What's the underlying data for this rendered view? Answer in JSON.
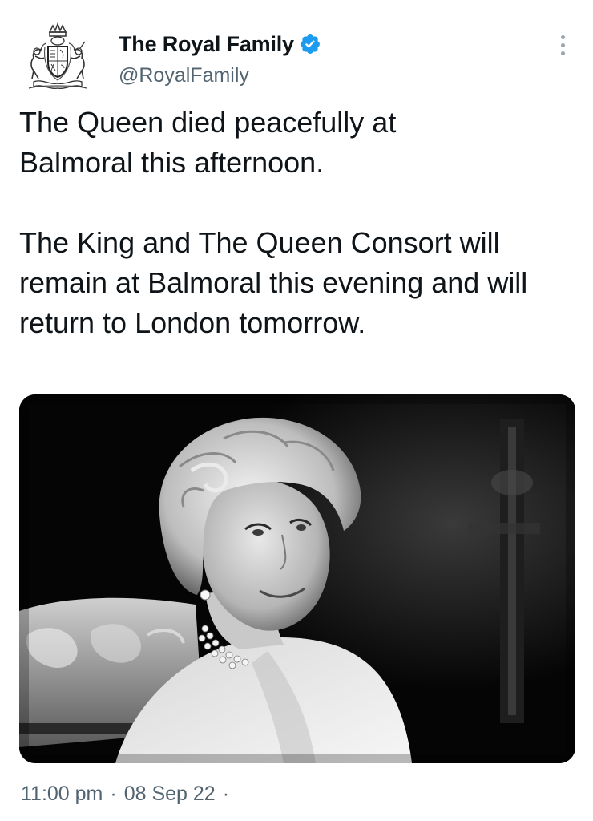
{
  "tweet": {
    "author": {
      "display_name": "The Royal Family",
      "handle": "@RoyalFamily",
      "verified": true,
      "avatar_icon": "royal-coat-of-arms-icon"
    },
    "body": {
      "paragraph_1": "The Queen died peacefully at Balmoral this afternoon.",
      "paragraph_2": "The King and The Queen Consort will remain at Balmoral this evening and will return to London tomorrow."
    },
    "meta": {
      "time": "11:00 pm",
      "separator": "·",
      "date": "08 Sep 22",
      "trailing_separator": "·"
    },
    "menu_icon": "more-options-icon"
  },
  "colors": {
    "text_primary": "#0f1419",
    "text_secondary": "#536471",
    "verified_blue": "#1d9bf0",
    "background": "#ffffff"
  }
}
